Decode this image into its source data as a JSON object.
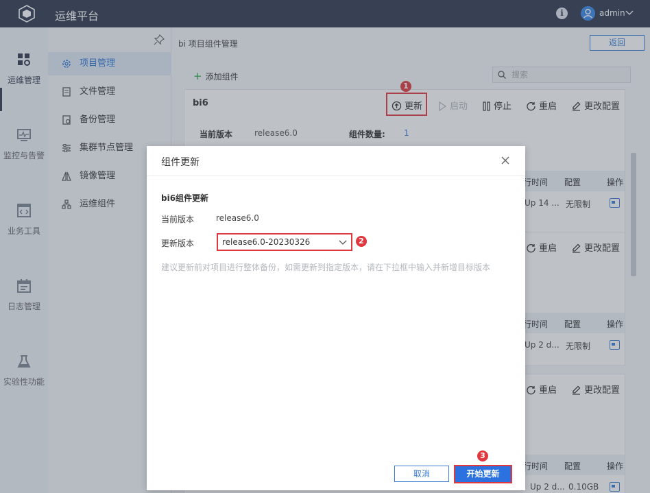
{
  "app": {
    "title": "运维平台",
    "user": "admin"
  },
  "rail": {
    "items": [
      {
        "label": "运维管理",
        "icon": "grid-settings-icon"
      },
      {
        "label": "监控与告警",
        "icon": "monitor-icon"
      },
      {
        "label": "业务工具",
        "icon": "code-window-icon"
      },
      {
        "label": "日志管理",
        "icon": "calendar-log-icon"
      },
      {
        "label": "实验性功能",
        "icon": "flask-icon"
      }
    ]
  },
  "subnav": {
    "items": [
      {
        "label": "项目管理",
        "icon": "gear-icon"
      },
      {
        "label": "文件管理",
        "icon": "file-icon"
      },
      {
        "label": "备份管理",
        "icon": "backup-icon"
      },
      {
        "label": "集群节点管理",
        "icon": "sliders-icon"
      },
      {
        "label": "镜像管理",
        "icon": "mirror-icon"
      },
      {
        "label": "运维组件",
        "icon": "component-icon"
      }
    ]
  },
  "main": {
    "breadcrumb": "bi 项目组件管理",
    "back_label": "返回",
    "add_label": "添加组件",
    "search_placeholder": "搜索",
    "card1": {
      "title": "bi6",
      "actions": {
        "update": "更新",
        "start": "启动",
        "stop": "停止",
        "restart": "重启",
        "config": "更改配置"
      },
      "current_version_label": "当前版本",
      "current_version": "release6.0",
      "count_label": "组件数量:",
      "count": "1",
      "table_headers": {
        "runtime": "运行时间",
        "config": "配置",
        "ops": "操作"
      },
      "row": {
        "runtime": "Up 14 ...",
        "config": "无限制"
      }
    },
    "card2": {
      "actions": {
        "restart": "重启",
        "config": "更改配置"
      },
      "table_headers": {
        "runtime": "运行时间",
        "config": "配置",
        "ops": "操作"
      },
      "row": {
        "runtime": "Up 2 d...",
        "config": "无限制"
      }
    },
    "card3": {
      "actions": {
        "restart": "重启",
        "config": "更改配置"
      },
      "table_headers": {
        "runtime": "运行时间",
        "config": "配置",
        "ops": "操作"
      },
      "row": {
        "runtime": "Up 2 d...",
        "config": "0.10GB"
      }
    }
  },
  "modal": {
    "title": "组件更新",
    "subtitle": "bi6组件更新",
    "current_label": "当前版本",
    "current_value": "release6.0",
    "update_label": "更新版本",
    "selected_version": "release6.0-20230326",
    "hint": "建议更新前对项目进行整体备份，如需更新到指定版本，请在下拉框中输入并新增目标版本",
    "cancel_label": "取消",
    "start_label": "开始更新"
  },
  "annotations": [
    "1",
    "2",
    "3"
  ],
  "colors": {
    "topbar": "#303a4e",
    "accent": "#2b72e0",
    "highlight": "#e0383e"
  }
}
